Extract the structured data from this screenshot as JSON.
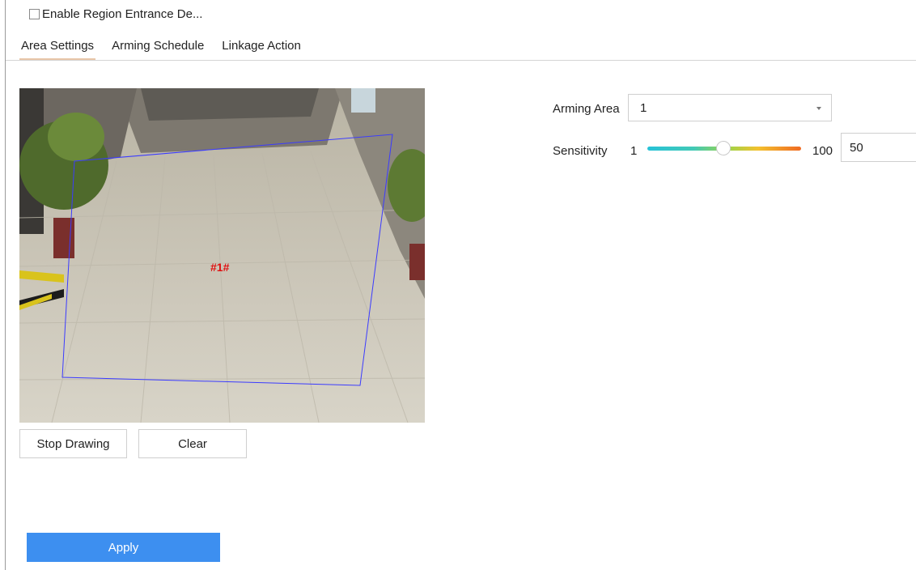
{
  "enable": {
    "label": "Enable Region Entrance De...",
    "checked": false
  },
  "tabs": [
    {
      "label": "Area Settings",
      "active": true
    },
    {
      "label": "Arming Schedule",
      "active": false
    },
    {
      "label": "Linkage Action",
      "active": false
    }
  ],
  "video": {
    "region_label": "#1#",
    "region_color": "#3b3bff",
    "label_color": "#e01010"
  },
  "buttons": {
    "stop_drawing": "Stop Drawing",
    "clear": "Clear",
    "apply": "Apply"
  },
  "settings": {
    "arming_area_label": "Arming Area",
    "arming_area_value": "1",
    "sensitivity_label": "Sensitivity",
    "sensitivity_min": "1",
    "sensitivity_max": "100",
    "sensitivity_value": "50"
  },
  "colors": {
    "accent": "#3d8ff0",
    "tab_underline": "#e8c6a8"
  }
}
